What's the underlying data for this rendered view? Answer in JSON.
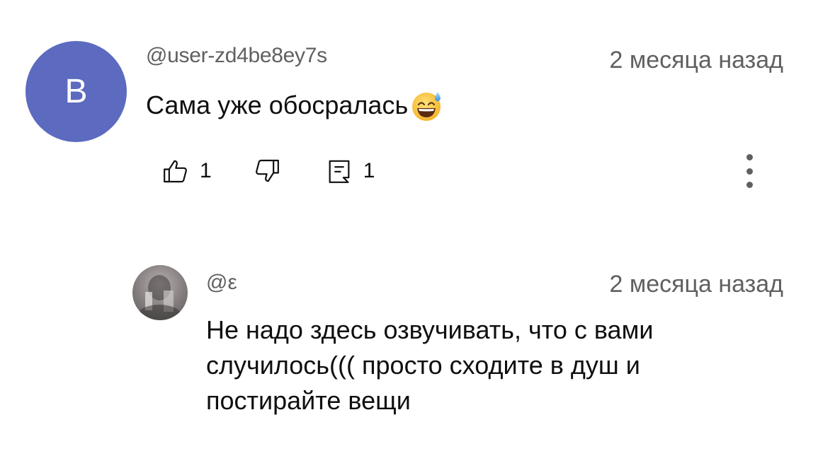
{
  "comment": {
    "avatar_letter": "B",
    "avatar_color": "#5c6bc0",
    "author": "@user-zd4be8ey7s",
    "time": "2 месяца назад",
    "text": "Сама уже обосралась",
    "emoji": "grinning-face-with-sweat",
    "likes": "1",
    "replies": "1",
    "icons": {
      "like": "thumbs-up-icon",
      "dislike": "thumbs-down-icon",
      "reply": "comment-icon",
      "more": "vertical-ellipsis-icon"
    }
  },
  "reply": {
    "author": "@ε",
    "time": "2 месяца назад",
    "text": "Не надо здесь озвучивать, что с вами случилось((( просто сходите в душ и постирайте вещи"
  }
}
